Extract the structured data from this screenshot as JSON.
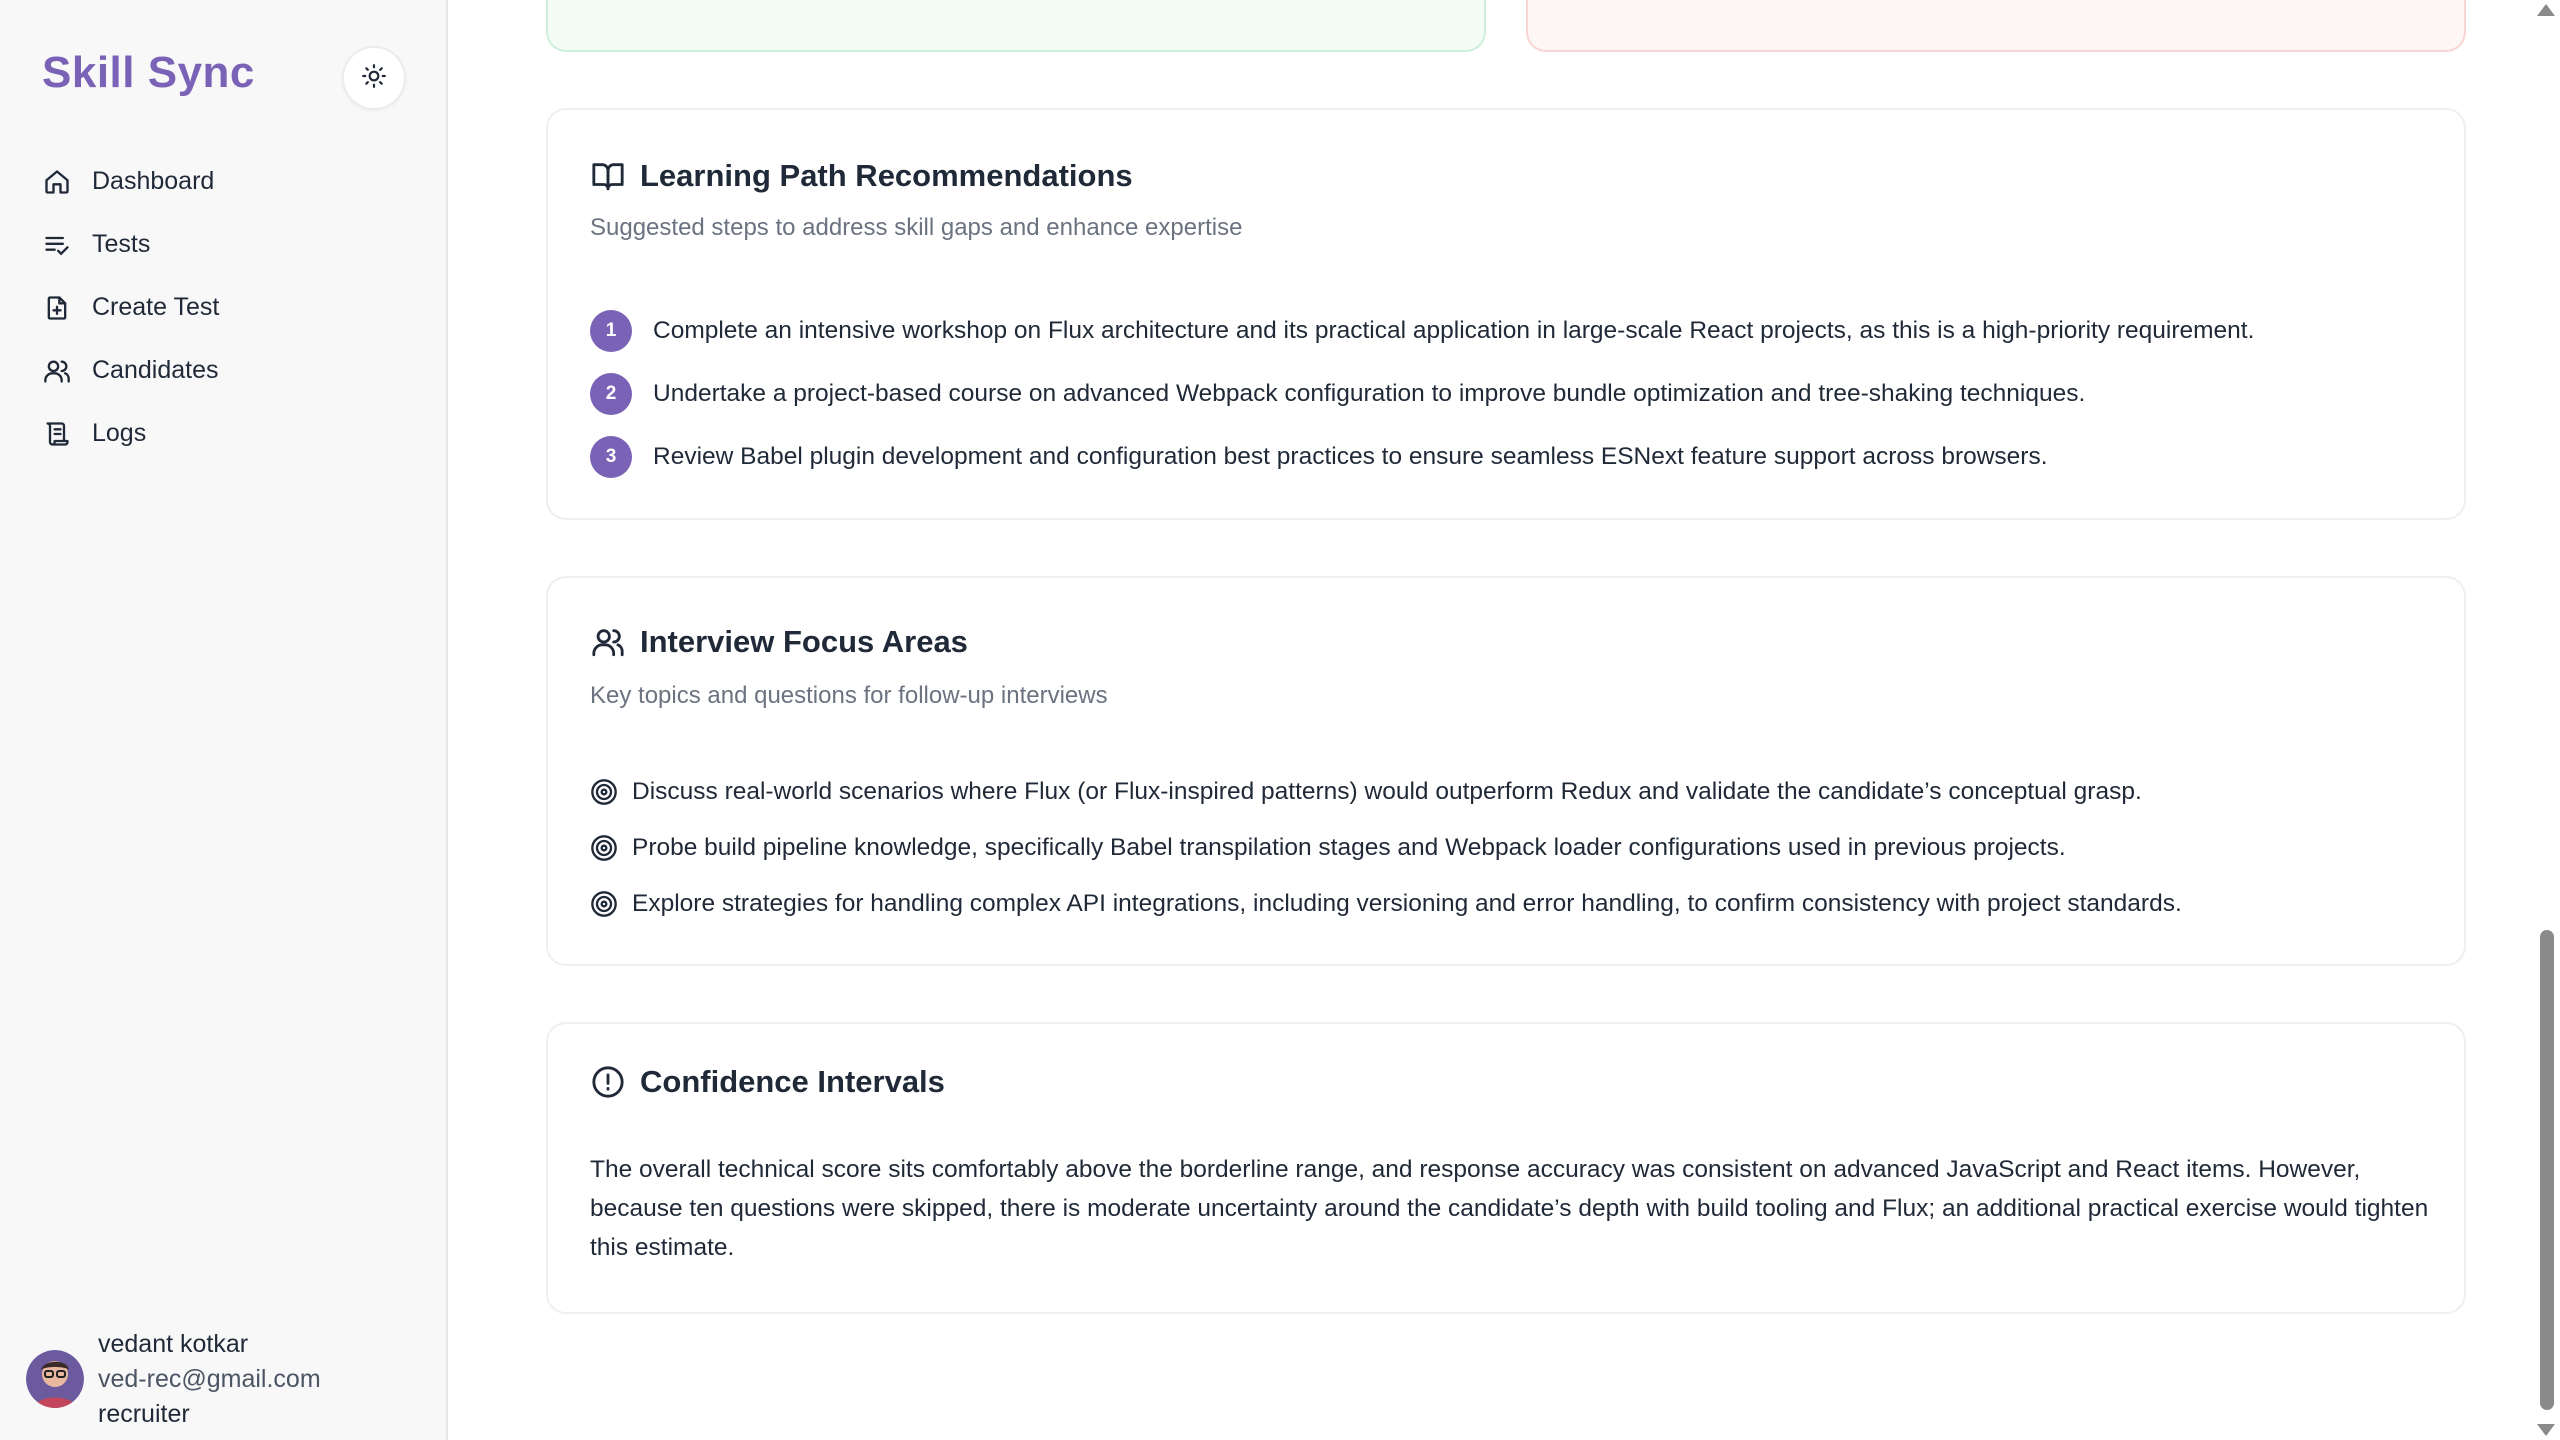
{
  "app": {
    "brand": "Skill Sync",
    "accent": "#7a63b6"
  },
  "sidebar": {
    "theme_toggle_icon": "sun-icon",
    "items": [
      {
        "label": "Dashboard",
        "icon": "home-icon"
      },
      {
        "label": "Tests",
        "icon": "list-check-icon"
      },
      {
        "label": "Create Test",
        "icon": "file-plus-icon"
      },
      {
        "label": "Candidates",
        "icon": "users-icon"
      },
      {
        "label": "Logs",
        "icon": "scroll-icon"
      }
    ]
  },
  "user": {
    "name": "vedant kotkar",
    "email": "ved-rec@gmail.com",
    "role": "recruiter"
  },
  "learning_path": {
    "title": "Learning Path Recommendations",
    "subtitle": "Suggested steps to address skill gaps and enhance expertise",
    "steps": [
      {
        "num": "1",
        "text": "Complete an intensive workshop on Flux architecture and its practical application in large-scale React projects, as this is a high-priority requirement."
      },
      {
        "num": "2",
        "text": "Undertake a project-based course on advanced Webpack configuration to improve bundle optimization and tree-shaking techniques."
      },
      {
        "num": "3",
        "text": "Review Babel plugin development and configuration best practices to ensure seamless ESNext feature support across browsers."
      }
    ]
  },
  "interview_focus": {
    "title": "Interview Focus Areas",
    "subtitle": "Key topics and questions for follow-up interviews",
    "items": [
      "Discuss real-world scenarios where Flux (or Flux-inspired patterns) would outperform Redux and validate the candidate’s conceptual grasp.",
      "Probe build pipeline knowledge, specifically Babel transpilation stages and Webpack loader configurations used in previous projects.",
      "Explore strategies for handling complex API integrations, including versioning and error handling, to confirm consistency with project standards."
    ]
  },
  "confidence": {
    "title": "Confidence Intervals",
    "text": "The overall technical score sits comfortably above the borderline range, and response accuracy was consistent on advanced JavaScript and React items. However, because ten questions were skipped, there is moderate uncertainty around the candidate’s depth with build tooling and Flux; an additional practical exercise would tighten this estimate."
  }
}
